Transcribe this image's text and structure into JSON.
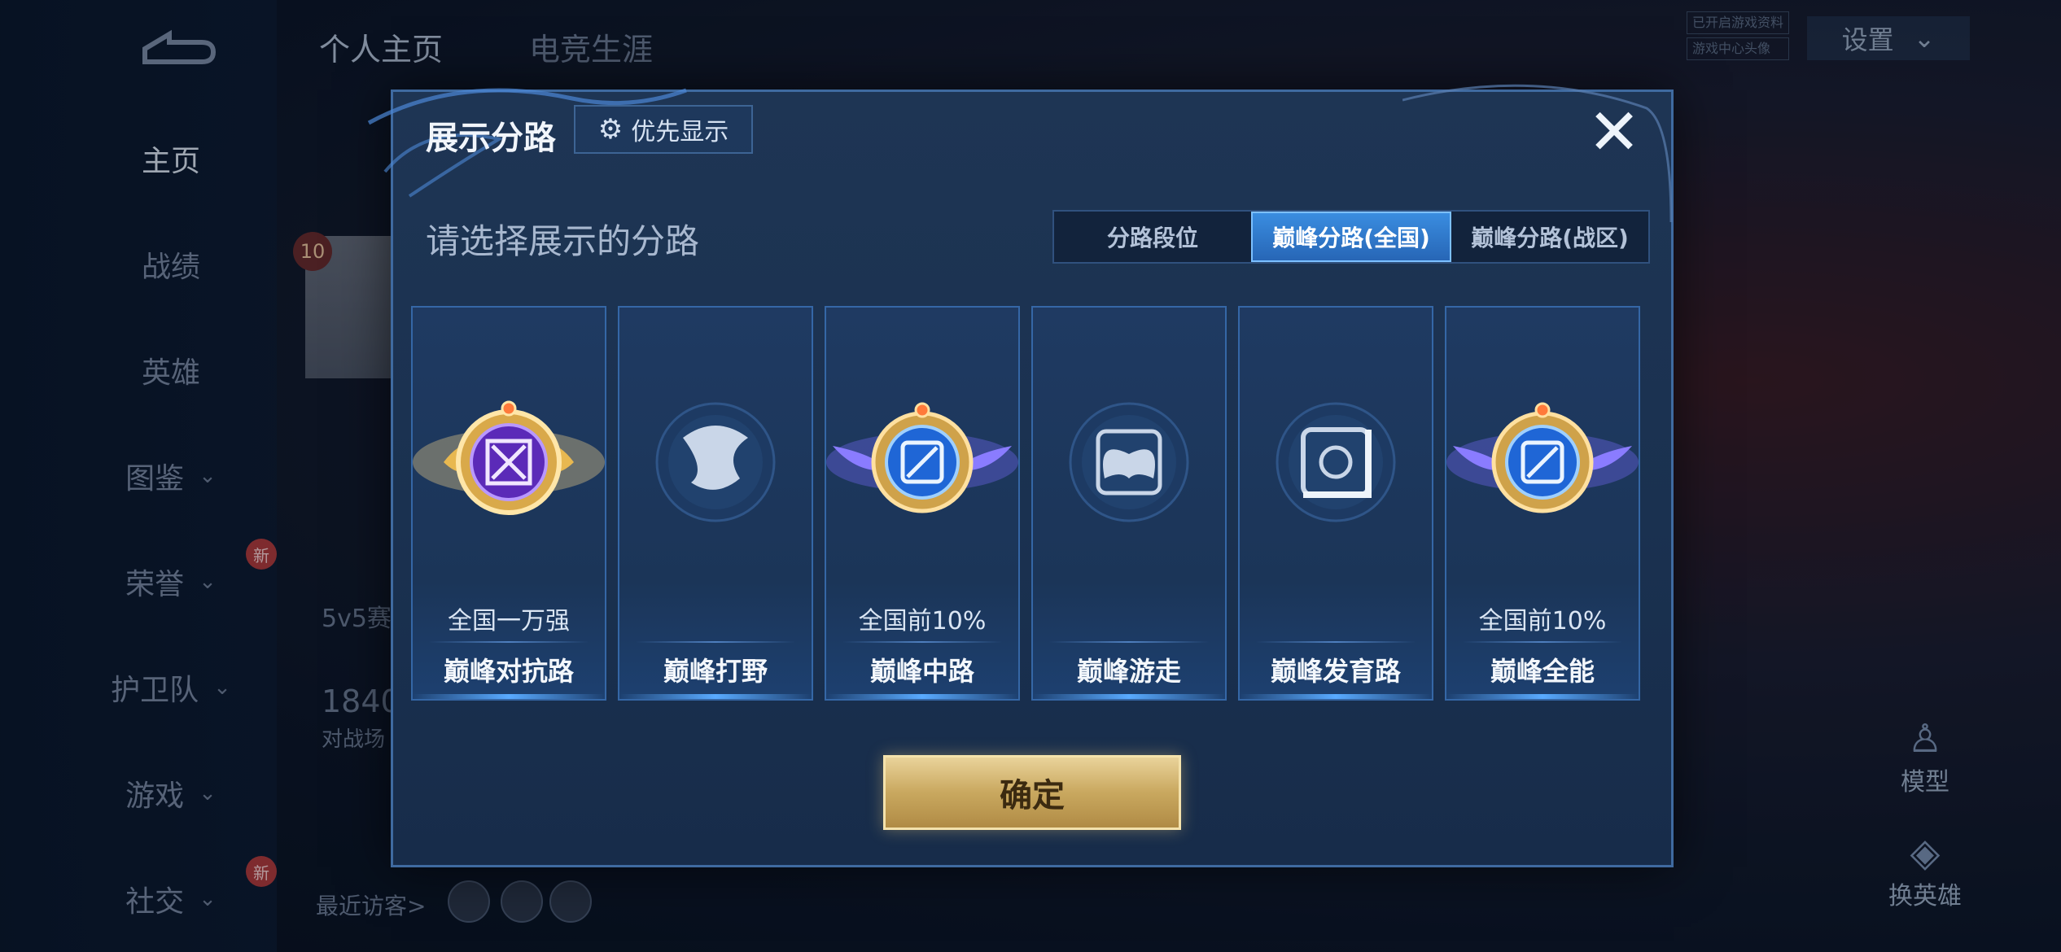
{
  "background": {
    "top_tabs": [
      "个人主页",
      "电竞生涯"
    ],
    "nav_items": [
      {
        "label": "主页",
        "chevron": false,
        "active": true
      },
      {
        "label": "战绩",
        "chevron": false
      },
      {
        "label": "英雄",
        "chevron": false
      },
      {
        "label": "图鉴",
        "chevron": true
      },
      {
        "label": "荣誉",
        "chevron": true,
        "badge": "新"
      },
      {
        "label": "护卫队",
        "chevron": true
      },
      {
        "label": "游戏",
        "chevron": true
      },
      {
        "label": "社交",
        "chevron": true,
        "badge": "新"
      }
    ],
    "settings_label": "设置",
    "tiny_tags": [
      "已开启游戏资料",
      "游戏中心头像"
    ],
    "level_badge": "10",
    "mode_text": "5v5赛",
    "stat_number": "1840",
    "stat_label": "对战场",
    "visitors_label": "最近访客>",
    "model_label": "模型",
    "swap_hero_label": "换英雄"
  },
  "dialog": {
    "title": "展示分路",
    "priority_label": "优先显示",
    "close_icon": "close-icon",
    "subtitle": "请选择展示的分路",
    "tabs": [
      {
        "label": "分路段位",
        "selected": false
      },
      {
        "label": "巅峰分路(全国)",
        "selected": true
      },
      {
        "label": "巅峰分路(战区)",
        "selected": false
      }
    ],
    "cards": [
      {
        "lane": "巅峰对抗路",
        "rank": "全国一万强",
        "icon": "clash-lane-emblem",
        "style": "gold"
      },
      {
        "lane": "巅峰打野",
        "rank": "",
        "icon": "jungle-dragon-emblem",
        "style": "plain"
      },
      {
        "lane": "巅峰中路",
        "rank": "全国前10%",
        "icon": "mid-lane-emblem",
        "style": "winged"
      },
      {
        "lane": "巅峰游走",
        "rank": "",
        "icon": "roam-wings-emblem",
        "style": "plain"
      },
      {
        "lane": "巅峰发育路",
        "rank": "",
        "icon": "farm-lane-emblem",
        "style": "plain"
      },
      {
        "lane": "巅峰全能",
        "rank": "全国前10%",
        "icon": "all-round-emblem",
        "style": "winged"
      }
    ],
    "confirm_label": "确定"
  },
  "colors": {
    "accent_blue": "#2f7ad0",
    "card_border": "#3567a6",
    "gold": "#c9a85f"
  }
}
